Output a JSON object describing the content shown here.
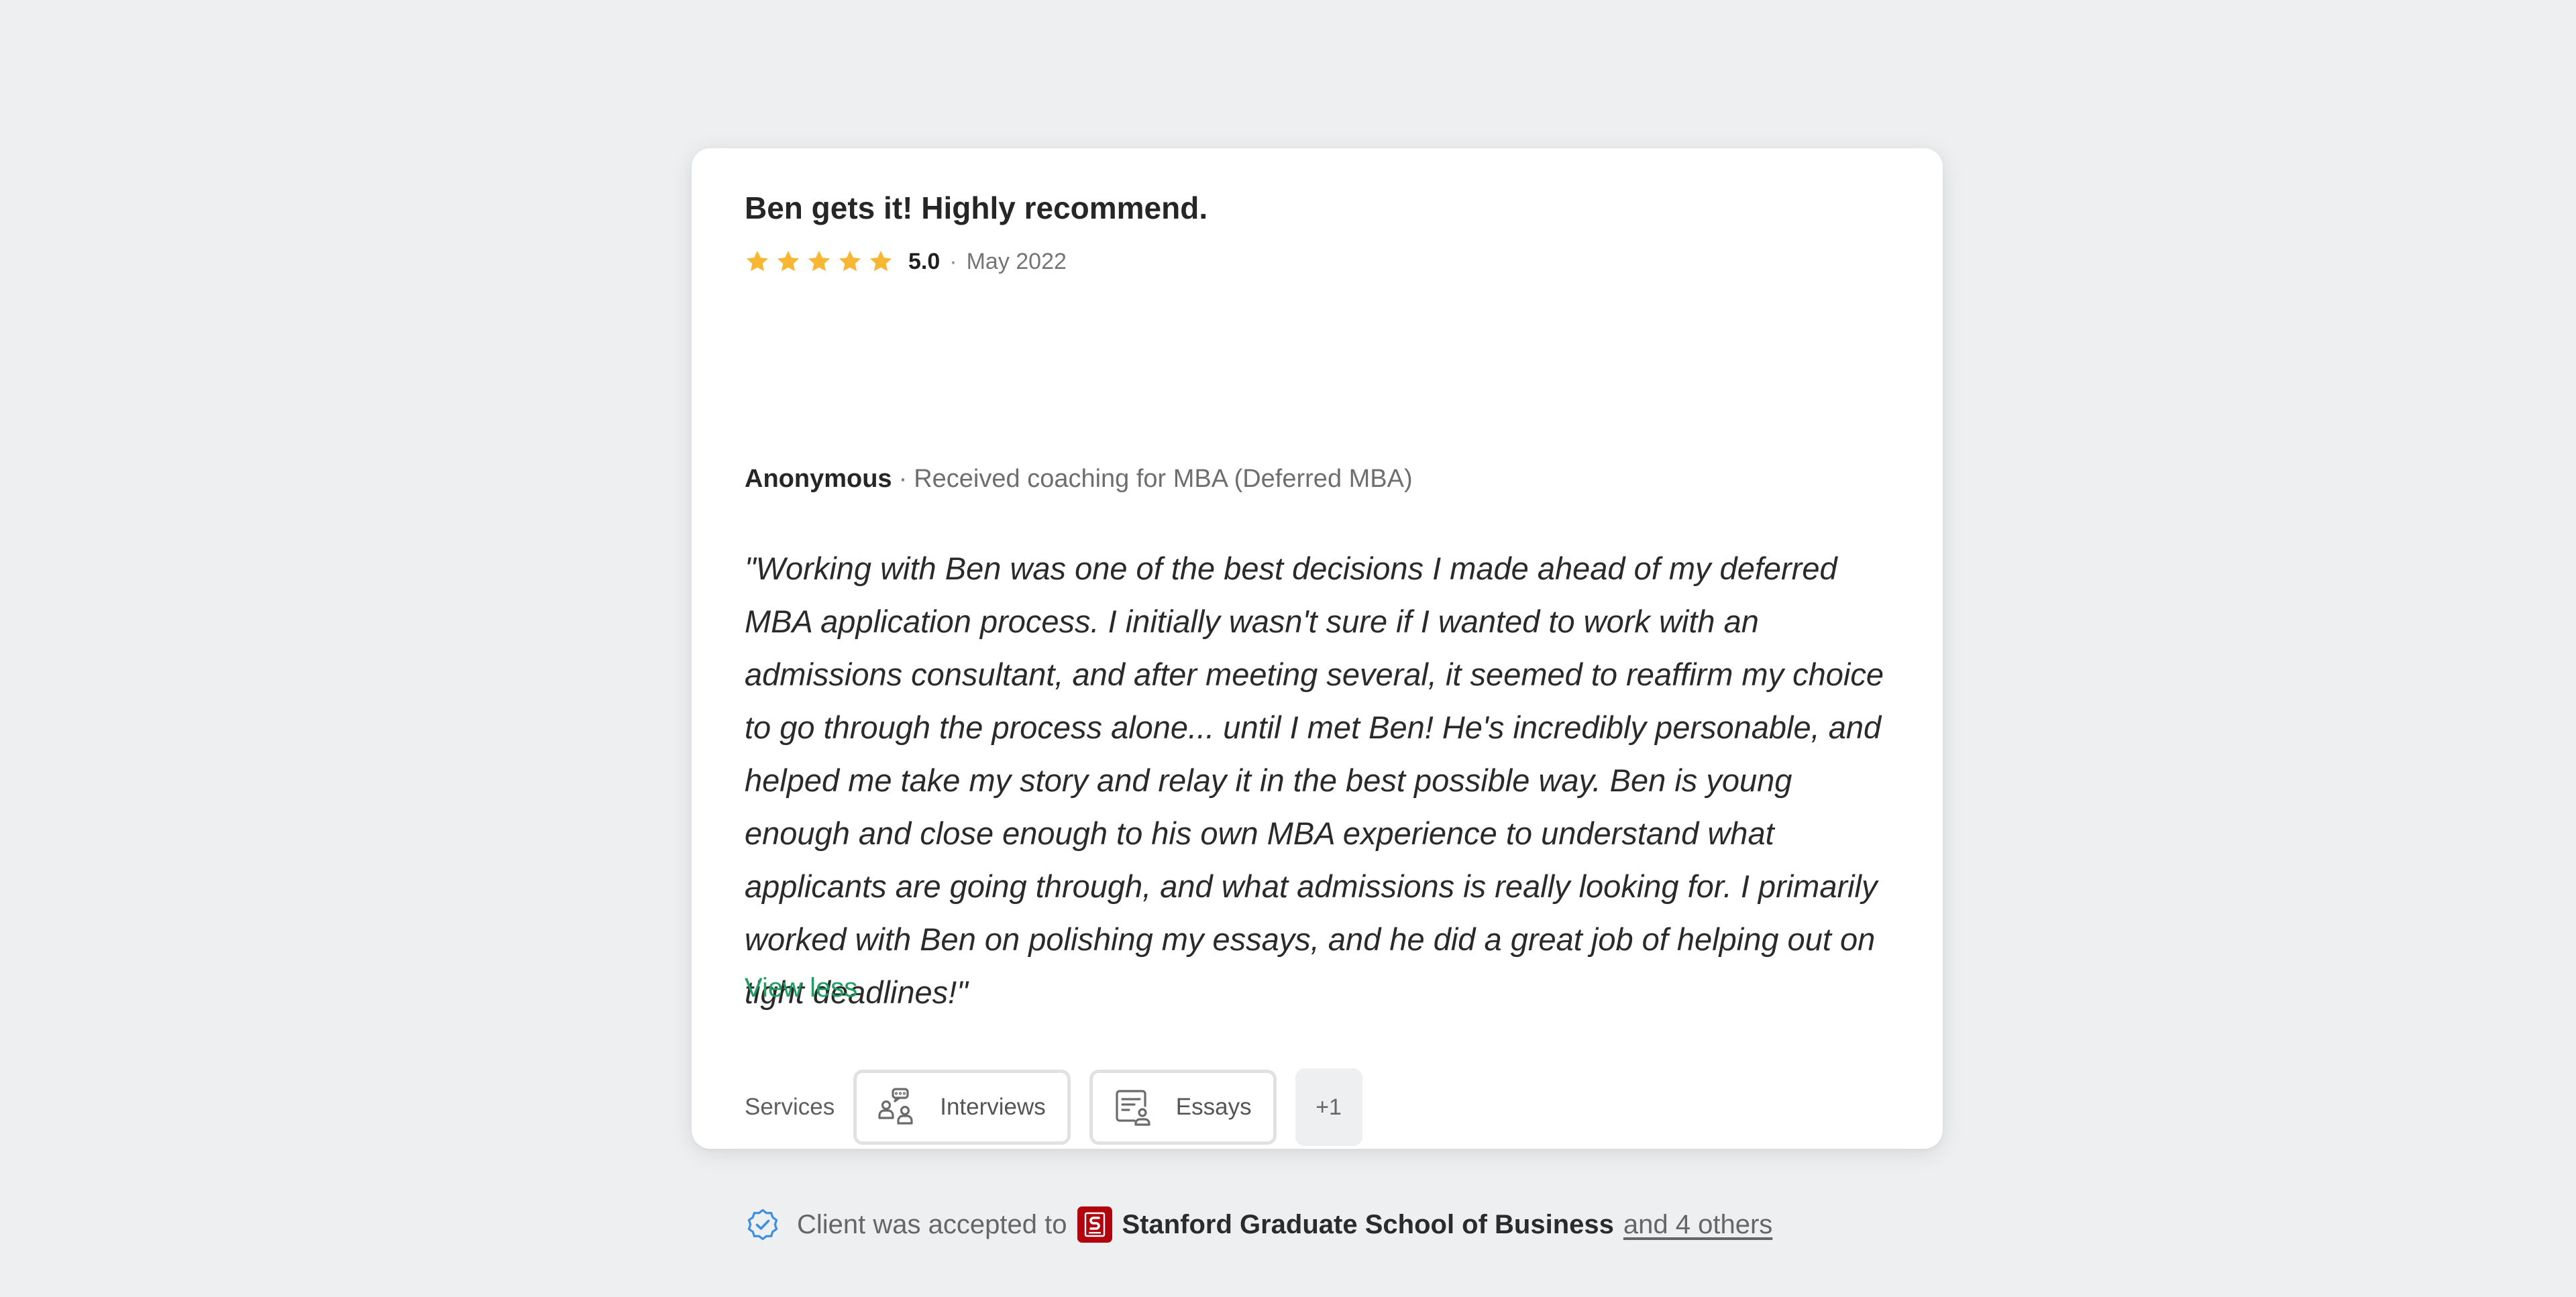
{
  "review": {
    "title": "Ben gets it! Highly recommend.",
    "rating": {
      "stars": 5,
      "max_stars": 5,
      "score_label": "5.0",
      "separator": "·",
      "date": "May 2022",
      "star_color": "#f7b733"
    },
    "author": {
      "name": "Anonymous",
      "separator": "·",
      "coaching": "Received coaching for MBA (Deferred MBA)"
    },
    "body": "\"Working with Ben was one of the best decisions I made ahead of my deferred MBA application process. I initially wasn't sure if I wanted to work with an admissions consultant, and after meeting several, it seemed to reaffirm my choice to go through the process alone... until I met Ben! He's incredibly personable, and helped me take my story and relay it in the best possible way. Ben is young enough and close enough to his own MBA experience to understand what applicants are going through, and what admissions is really looking for. I primarily worked with Ben on polishing my essays, and he did a great job of helping out on tight deadlines!\"",
    "view_less_label": "View less",
    "services": {
      "label": "Services",
      "items": [
        {
          "label": "Interviews",
          "icon": "interviews-icon"
        },
        {
          "label": "Essays",
          "icon": "essays-icon"
        }
      ],
      "more_label": "+1"
    },
    "accepted": {
      "text": "Client was accepted to",
      "school": "Stanford Graduate School of Business",
      "others_label": "and 4 others",
      "verified_icon": "verified-badge-icon",
      "school_logo": "stanford-logo-icon"
    }
  },
  "colors": {
    "background": "#eeeff1",
    "card": "#ffffff",
    "accent_green": "#1f9d63",
    "verified_blue": "#3d8fe0",
    "stanford_red": "#b1040e"
  }
}
